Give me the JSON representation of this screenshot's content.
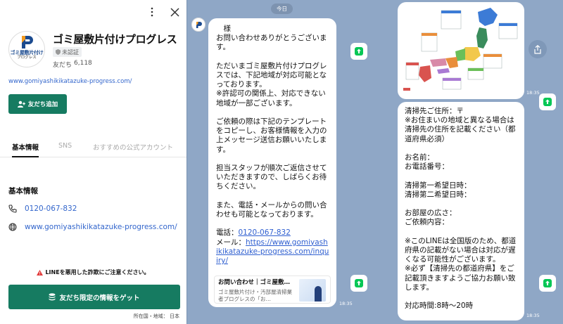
{
  "profile": {
    "account_name": "ゴミ屋敷片付けプログレス",
    "logo_text": "ゴミ屋敷片付け",
    "logo_subtext": "プログレス",
    "verification_label": "未認証",
    "friends_label": "友だち",
    "friends_count": "6,118",
    "url": "www.gomiyashikikatazuke-progress.com/",
    "add_friend_label": "友だち追加",
    "tabs": [
      "基本情報",
      "SNS",
      "おすすめの公式アカウント"
    ],
    "section_title": "基本情報",
    "phone": "0120-067-832",
    "website": "www.gomiyashikikatazuke-progress.com/",
    "fraud_warning": "LINEを悪用した詐欺にご注意ください。",
    "limited_info_label": "友だち限定の情報をゲット",
    "location": "所在国・地域： 日本"
  },
  "chat": {
    "date": "今日",
    "message1": {
      "greeting": "　様",
      "paragraphs": [
        "お問い合わせありがとうございます。",
        "ただいまゴミ屋敷片付けプログレスでは、下記地域が対応可能となっております。\n※許認可の関係上、対応できない地域が一部ございます。",
        "ご依頼の際は下記のテンプレートをコピーし、お客様情報を入力の上メッセージ送信お願いいたします。",
        "担当スタッフが順次ご返信させていただきますので、しばらくお待ちください。",
        "また、電話・メールからの問い合わせも可能となっております。"
      ],
      "phone_label": "電話：",
      "phone": "0120-067-832",
      "mail_label": "メール：",
      "mail_link": "https://www.gomiyashikikatazuke-progress.com/inquiry/",
      "card_title": "お問い合わせ｜ゴミ屋敷…",
      "card_desc": "ゴミ屋敷片付け・汚部屋清掃業者プログレスの「お…",
      "time": "18:35"
    },
    "map_time": "18:35",
    "message2": {
      "paragraphs": [
        "清掃先ご住所：〒\n※お住まいの地域と異なる場合は清掃先の住所を記載ください（都道府県必須）",
        "お名前：\nお電話番号：",
        "清掃第一希望日時：\n清掃第二希望日時：",
        "お部屋の広さ：\nご依頼内容：",
        "※このLINEは全国版のため、都道府県の記載がない場合は対応が遅くなる可能性がございます。\n※必ず【清掃先の都道府県】をご記載頂きますようご協力お願い致します。",
        "対応時間:8時～20時"
      ],
      "time": "18:35"
    }
  },
  "colors": {
    "brand_green": "#167b61",
    "chat_bg": "#8fa7c6",
    "link_blue": "#2f5fd0",
    "share_green": "#06c755"
  }
}
